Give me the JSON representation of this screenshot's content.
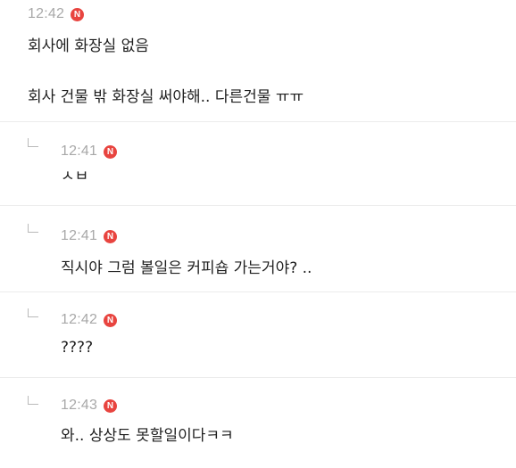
{
  "post": {
    "time": "12:42",
    "badge": "N",
    "line1": "회사에 화장실 없음",
    "line2": "회사 건물 밖 화장실 써야해.. 다른건물 ㅠㅠ"
  },
  "replies": [
    {
      "time": "12:41",
      "badge": "N",
      "text": "ㅅㅂ"
    },
    {
      "time": "12:41",
      "badge": "N",
      "text": "직시야 그럼 볼일은 커피숍 가는거야? .."
    },
    {
      "time": "12:42",
      "badge": "N",
      "text": "????"
    },
    {
      "time": "12:43",
      "badge": "N",
      "text": "와.. 상상도 못할일이다ㅋㅋ"
    }
  ]
}
